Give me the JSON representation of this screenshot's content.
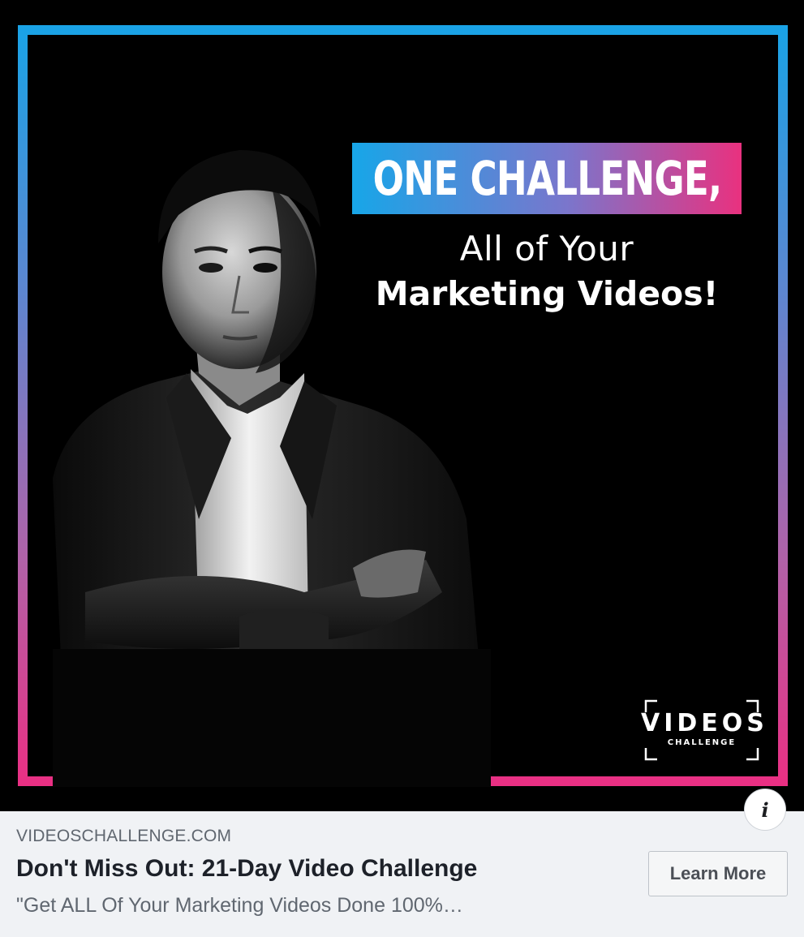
{
  "creative": {
    "headline": "ONE CHALLENGE,",
    "subline_1": "All of Your",
    "subline_2": "Marketing Videos!",
    "brand_logo": {
      "word": "VIDEOS",
      "sub": "CHALLENGE"
    },
    "colors": {
      "frame_top": "#19a3e6",
      "frame_bottom": "#ea2f83",
      "background": "#000000"
    }
  },
  "info_button": {
    "icon": "info-icon",
    "glyph": "i"
  },
  "footer": {
    "domain": "VIDEOSCHALLENGE.COM",
    "title": "Don't Miss Out: 21-Day Video Challenge",
    "description": "\"Get ALL Of Your Marketing Videos Done 100%…",
    "cta_label": "Learn More"
  }
}
